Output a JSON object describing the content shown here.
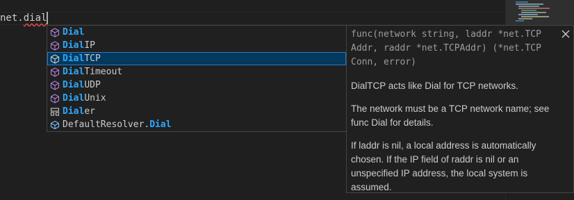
{
  "editor": {
    "line_text_plain": "net.",
    "line_text_error": "dial"
  },
  "suggestions": [
    {
      "icon": "method-icon",
      "match": "Dial",
      "rest": "",
      "prefix": ""
    },
    {
      "icon": "method-icon",
      "match": "Dial",
      "rest": "IP",
      "prefix": ""
    },
    {
      "icon": "method-icon",
      "match": "Dial",
      "rest": "TCP",
      "prefix": "",
      "selected": true
    },
    {
      "icon": "method-icon",
      "match": "Dial",
      "rest": "Timeout",
      "prefix": ""
    },
    {
      "icon": "method-icon",
      "match": "Dial",
      "rest": "UDP",
      "prefix": ""
    },
    {
      "icon": "method-icon",
      "match": "Dial",
      "rest": "Unix",
      "prefix": ""
    },
    {
      "icon": "struct-icon",
      "match": "Dial",
      "rest": "er",
      "prefix": ""
    },
    {
      "icon": "field-icon",
      "match": "Dial",
      "rest": "",
      "prefix": "DefaultResolver."
    }
  ],
  "details": {
    "signature_lines": [
      "func(network string, laddr *net.TCP",
      "Addr, raddr *net.TCPAddr) (*net.TCP",
      "Conn, error)"
    ],
    "paragraphs": [
      [
        "DialTCP acts like Dial for TCP networks."
      ],
      [
        "The network must be a TCP network name; see",
        "func Dial for details."
      ],
      [
        "If laddr is nil, a local address is automatically",
        "chosen. If the IP field of raddr is nil or an",
        "unspecified IP address, the local system is",
        "assumed."
      ]
    ]
  },
  "colors": {
    "highlight": "#2aaaff",
    "icon": "#b180d7",
    "field_icon": "#75beff",
    "selected_bg": "#04395e"
  }
}
